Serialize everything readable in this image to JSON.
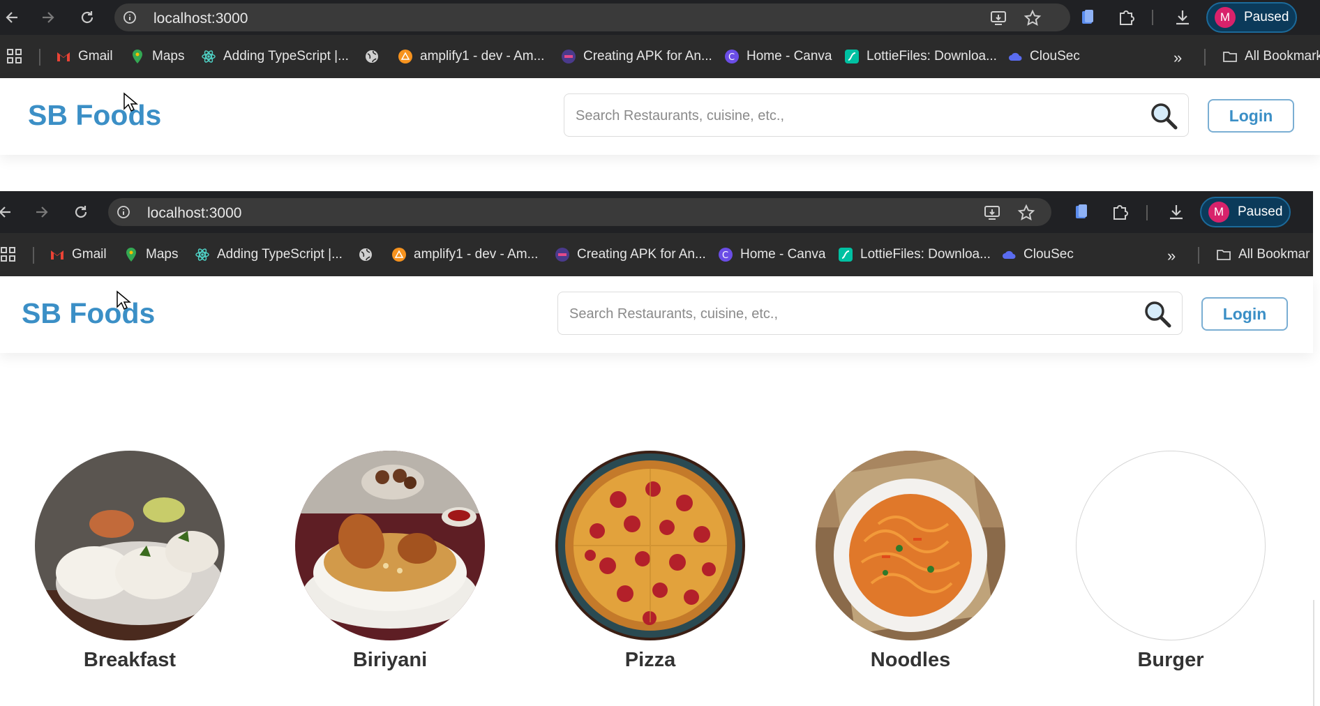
{
  "browser": {
    "url": "localhost:3000",
    "profile_initial": "M",
    "profile_status": "Paused",
    "bookmarks": [
      {
        "label": "Gmail",
        "icon": "gmail-icon"
      },
      {
        "label": "Maps",
        "icon": "maps-pin-icon"
      },
      {
        "label": "Adding TypeScript |...",
        "icon": "react-icon"
      },
      {
        "label": "",
        "icon": "globe-icon"
      },
      {
        "label": "amplify1 - dev - Am...",
        "icon": "amplify-icon"
      },
      {
        "label": "Creating APK for An...",
        "icon": "site-icon"
      },
      {
        "label": "Home - Canva",
        "icon": "canva-icon"
      },
      {
        "label": "LottieFiles: Downloa...",
        "icon": "lottie-icon"
      },
      {
        "label": "ClouSec",
        "icon": "clousec-icon"
      }
    ],
    "all_bookmarks_top": "All Bookmark",
    "all_bookmarks_mid": "All Bookmar"
  },
  "site": {
    "brand": "SB Foods",
    "search_placeholder": "Search Restaurants, cuisine, etc.,",
    "login_label": "Login",
    "accent_color": "#3b8fc6"
  },
  "categories": [
    {
      "label": "Breakfast"
    },
    {
      "label": "Biriyani"
    },
    {
      "label": "Pizza"
    },
    {
      "label": "Noodles"
    },
    {
      "label": "Burger"
    }
  ]
}
